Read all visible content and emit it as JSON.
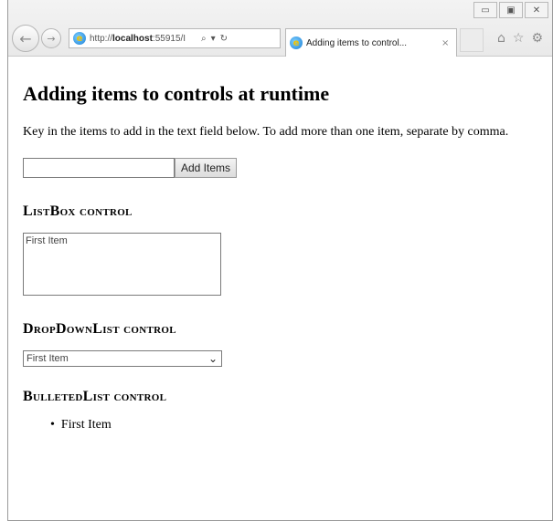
{
  "browser": {
    "url_prefix": "http://",
    "url_host": "localhost",
    "url_rest": ":55915/I",
    "tab_title": "Adding items to control...",
    "tab_close": "×",
    "window_buttons": [
      "▭",
      "▣",
      "✕"
    ],
    "icons": [
      "back-arrow",
      "forward-arrow",
      "ie-logo",
      "search-icon",
      "refresh-icon",
      "home-icon",
      "favorites-star-icon",
      "gear-icon"
    ]
  },
  "page": {
    "heading": "Adding items to controls at runtime",
    "intro": "Key in the items to add in the text field below. To add more than one item, separate by comma.",
    "text_field_value": "",
    "add_button_label": "Add Items",
    "listbox_heading": "ListBox control",
    "listbox_items": [
      "First Item"
    ],
    "dropdown_heading": "DropDownList control",
    "dropdown_selected": "First Item",
    "bulleted_heading": "BulletedList control",
    "bulleted_items": [
      "First Item"
    ]
  }
}
